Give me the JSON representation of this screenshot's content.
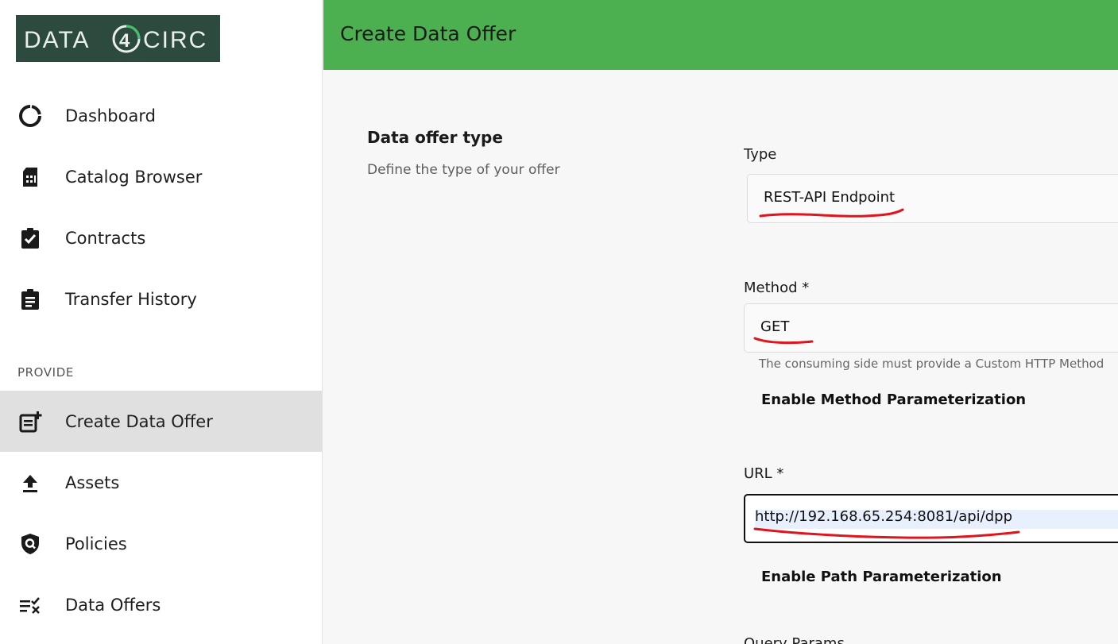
{
  "logo": {
    "text": "DATA4CIRC"
  },
  "sidebar": {
    "items": [
      {
        "label": "Dashboard",
        "icon": "dashboard-icon"
      },
      {
        "label": "Catalog Browser",
        "icon": "catalog-icon"
      },
      {
        "label": "Contracts",
        "icon": "contracts-icon"
      },
      {
        "label": "Transfer History",
        "icon": "transfer-history-icon"
      }
    ],
    "section_provide": "PROVIDE",
    "provide_items": [
      {
        "label": "Create Data Offer",
        "icon": "create-offer-icon",
        "active": true
      },
      {
        "label": "Assets",
        "icon": "upload-icon"
      },
      {
        "label": "Policies",
        "icon": "policy-shield-icon"
      },
      {
        "label": "Data Offers",
        "icon": "data-offers-icon"
      }
    ]
  },
  "header": {
    "title": "Create Data Offer"
  },
  "form": {
    "section_title": "Data offer type",
    "section_desc": "Define the type of your offer",
    "type": {
      "label": "Type",
      "value": "REST-API Endpoint"
    },
    "method": {
      "label": "Method *",
      "value": "GET",
      "hint": "The consuming side must provide a Custom HTTP Method",
      "toggle_label": "Enable Method Parameterization"
    },
    "url": {
      "label": "URL *",
      "value": "http://192.168.65.254:8081/api/dpp",
      "toggle_label": "Enable Path Parameterization"
    },
    "next_label": "Query Params"
  },
  "colors": {
    "header": "#4caf50",
    "logo_bg": "#2d4a3f",
    "active_item": "#e0e0e0",
    "annotation": "#e0141c"
  }
}
